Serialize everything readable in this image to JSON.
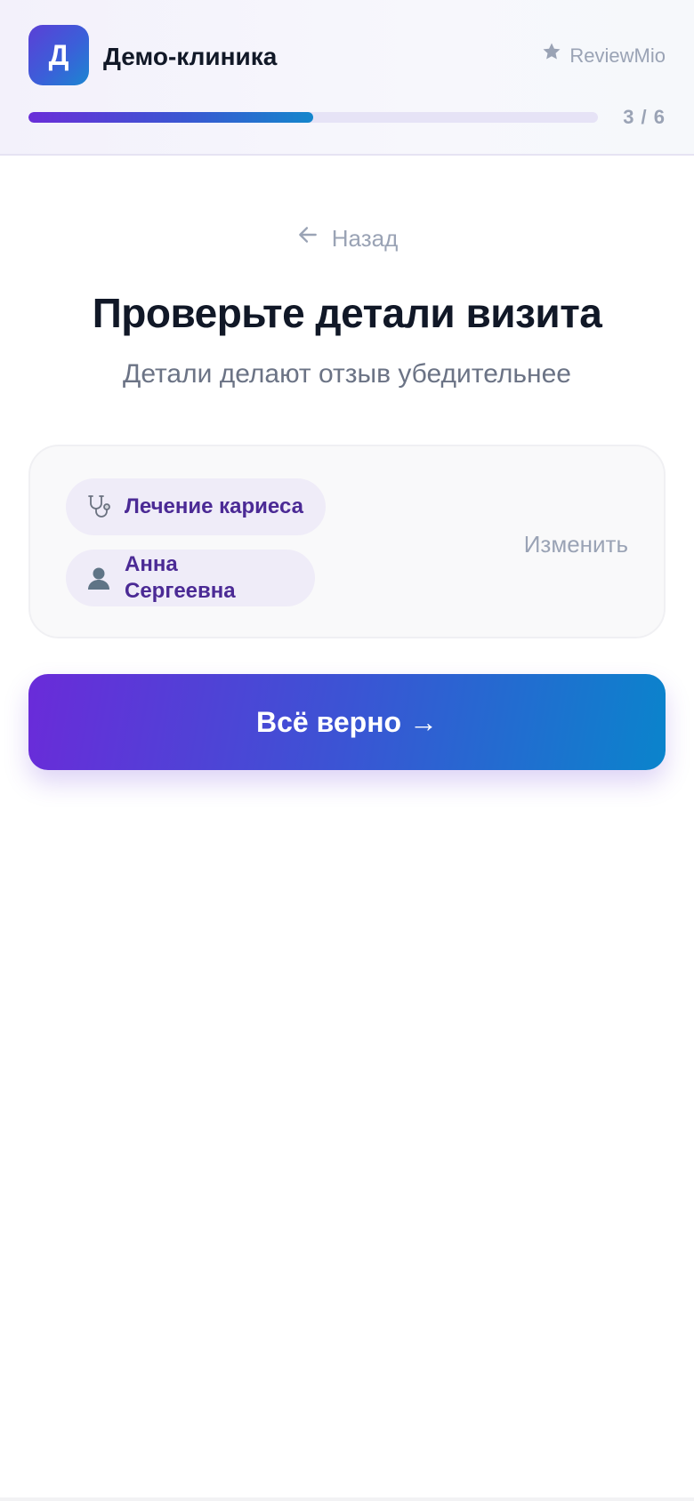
{
  "header": {
    "logo_letter": "Д",
    "clinic_name": "Демо-клиника",
    "brand_label": "ReviewMio",
    "progress": {
      "current": 3,
      "total": 6,
      "text": "3 / 6",
      "fill_fraction": 0.5
    }
  },
  "nav": {
    "back_label": "Назад"
  },
  "main": {
    "title": "Проверьте детали визита",
    "subtitle": "Детали делают отзыв убедительнее"
  },
  "visit_card": {
    "service": {
      "icon": "stethoscope-icon",
      "label": "Лечение кариеса"
    },
    "doctor": {
      "icon": "person-icon",
      "label": "Анна Сергеевна"
    },
    "change_label": "Изменить"
  },
  "cta": {
    "label": "Всё верно →"
  },
  "colors": {
    "accent_purple": "#6a2bd9",
    "accent_blue": "#0a84cc",
    "chip_text": "#4b2a95",
    "muted_text": "#9aa3b5"
  }
}
